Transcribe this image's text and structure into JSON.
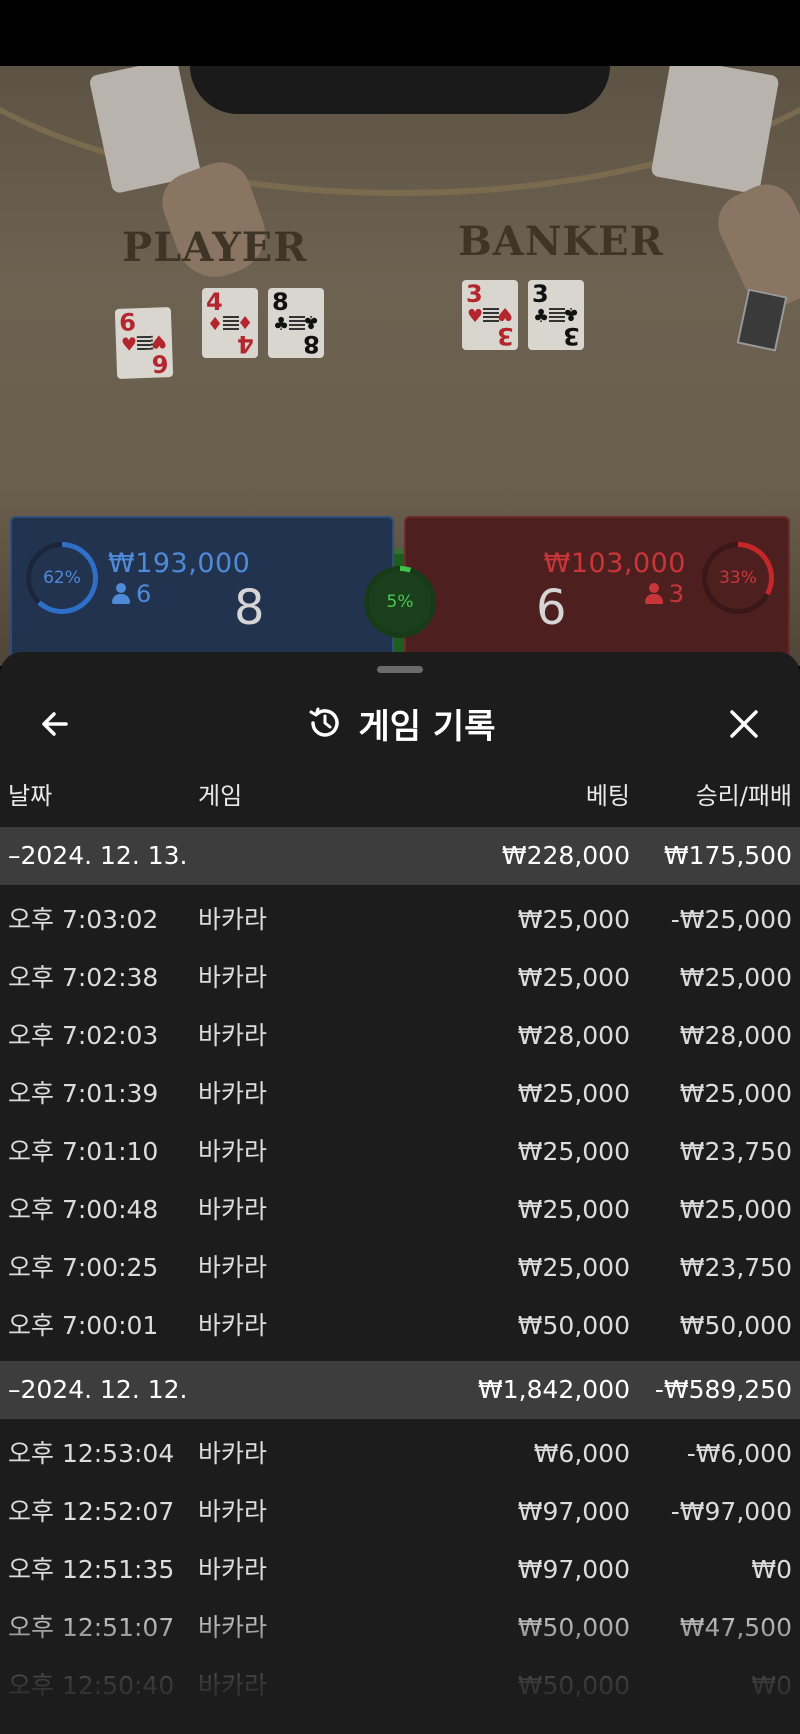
{
  "video": {
    "player_word": "PLAYER",
    "banker_word": "BANKER",
    "player_cards": [
      {
        "rank": "6",
        "suit": "♥",
        "color": "#b3262e"
      },
      {
        "rank": "4",
        "suit": "♦",
        "color": "#b3262e"
      },
      {
        "rank": "8",
        "suit": "♣",
        "color": "#111111"
      }
    ],
    "banker_cards": [
      {
        "rank": "3",
        "suit": "♥",
        "color": "#b3262e"
      },
      {
        "rank": "3",
        "suit": "♣",
        "color": "#111111"
      }
    ]
  },
  "bets": {
    "player": {
      "percent": "62%",
      "amount": "₩193,000",
      "users": "6",
      "score": "8",
      "percent_value": 62,
      "color": "#2f6fc6"
    },
    "tie": {
      "percent": "5%",
      "percent_value": 5,
      "color": "#3ec24a"
    },
    "banker": {
      "percent": "33%",
      "amount": "₩103,000",
      "users": "3",
      "score": "6",
      "percent_value": 33,
      "color": "#c4262a"
    }
  },
  "sheet": {
    "title": "게임 기록",
    "columns": {
      "date": "날짜",
      "game": "게임",
      "bet": "베팅",
      "result": "승리/패배"
    },
    "groups": [
      {
        "date": "–2024. 12. 13.",
        "bet_total": "₩228,000",
        "result_total": "₩175,500",
        "rows": [
          {
            "time": "오후 7:03:02",
            "game": "바카라",
            "bet": "₩25,000",
            "result": "-₩25,000"
          },
          {
            "time": "오후 7:02:38",
            "game": "바카라",
            "bet": "₩25,000",
            "result": "₩25,000"
          },
          {
            "time": "오후 7:02:03",
            "game": "바카라",
            "bet": "₩28,000",
            "result": "₩28,000"
          },
          {
            "time": "오후 7:01:39",
            "game": "바카라",
            "bet": "₩25,000",
            "result": "₩25,000"
          },
          {
            "time": "오후 7:01:10",
            "game": "바카라",
            "bet": "₩25,000",
            "result": "₩23,750"
          },
          {
            "time": "오후 7:00:48",
            "game": "바카라",
            "bet": "₩25,000",
            "result": "₩25,000"
          },
          {
            "time": "오후 7:00:25",
            "game": "바카라",
            "bet": "₩25,000",
            "result": "₩23,750"
          },
          {
            "time": "오후 7:00:01",
            "game": "바카라",
            "bet": "₩50,000",
            "result": "₩50,000"
          }
        ]
      },
      {
        "date": "–2024. 12. 12.",
        "bet_total": "₩1,842,000",
        "result_total": "-₩589,250",
        "rows": [
          {
            "time": "오후 12:53:04",
            "game": "바카라",
            "bet": "₩6,000",
            "result": "-₩6,000"
          },
          {
            "time": "오후 12:52:07",
            "game": "바카라",
            "bet": "₩97,000",
            "result": "-₩97,000"
          },
          {
            "time": "오후 12:51:35",
            "game": "바카라",
            "bet": "₩97,000",
            "result": "₩0"
          },
          {
            "time": "오후 12:51:07",
            "game": "바카라",
            "bet": "₩50,000",
            "result": "₩47,500"
          },
          {
            "time": "오후 12:50:40",
            "game": "바카라",
            "bet": "₩50,000",
            "result": "₩0"
          }
        ]
      }
    ]
  }
}
